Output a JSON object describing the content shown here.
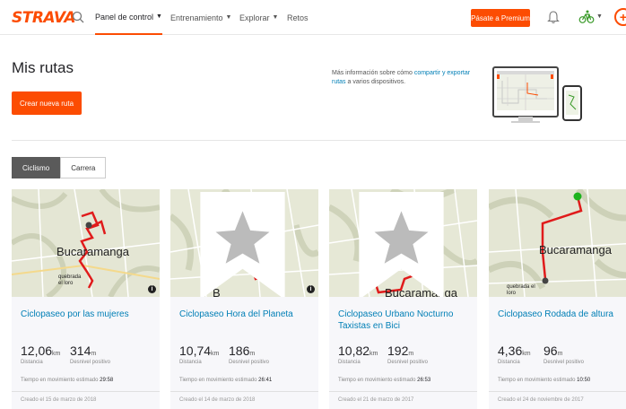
{
  "header": {
    "logo": "STRAVA",
    "nav": [
      {
        "label": "Panel de control"
      },
      {
        "label": "Entrenamiento"
      },
      {
        "label": "Explorar"
      },
      {
        "label": "Retos"
      }
    ],
    "premium_label": "Pásate a Premium",
    "accent": "#fc4c02"
  },
  "page": {
    "title": "Mis rutas",
    "create_label": "Crear nueva ruta",
    "info_prefix": "Más información sobre cómo ",
    "info_link": "compartir y exportar rutas",
    "info_suffix": " a varios dispositivos."
  },
  "tabs": [
    {
      "label": "Ciclismo",
      "active": true
    },
    {
      "label": "Carrera",
      "active": false
    }
  ],
  "routes": [
    {
      "title": "Ciclopaseo por las mujeres",
      "distance": "12,06",
      "distance_unit": "km",
      "distance_label": "Distancia",
      "elevation": "314",
      "elevation_unit": "m",
      "elevation_label": "Desnivel positivo",
      "est_label": "Tiempo en movimiento estimado",
      "est_time": "29:58",
      "created": "Creado el 15 de marzo de 2018",
      "map_label": "Bucaramanga",
      "map_sub": "quebrada el loro"
    },
    {
      "title": "Ciclopaseo Hora del Planeta",
      "distance": "10,74",
      "distance_unit": "km",
      "distance_label": "Distancia",
      "elevation": "186",
      "elevation_unit": "m",
      "elevation_label": "Desnivel positivo",
      "est_label": "Tiempo en movimiento estimado",
      "est_time": "26:41",
      "created": "Creado el 14 de marzo de 2018",
      "map_label": "B"
    },
    {
      "title": "Ciclopaseo Urbano Nocturno Taxistas en Bici",
      "distance": "10,82",
      "distance_unit": "km",
      "distance_label": "Distancia",
      "elevation": "192",
      "elevation_unit": "m",
      "elevation_label": "Desnivel positivo",
      "est_label": "Tiempo en movimiento estimado",
      "est_time": "26:53",
      "created": "Creado el 21 de marzo de 2017",
      "map_label": "Bucaramanga"
    },
    {
      "title": "Ciclopaseo Rodada de altura",
      "distance": "4,36",
      "distance_unit": "km",
      "distance_label": "Distancia",
      "elevation": "96",
      "elevation_unit": "m",
      "elevation_label": "Desnivel positivo",
      "est_label": "Tiempo en movimiento estimado",
      "est_time": "10:50",
      "created": "Creado el 24 de noviembre de 2017",
      "map_label": "Bucaramanga",
      "map_sub": "quebrada el loro"
    }
  ]
}
